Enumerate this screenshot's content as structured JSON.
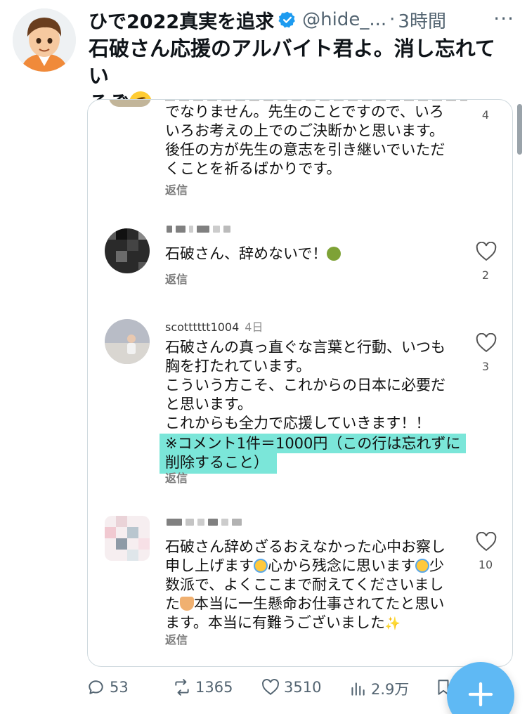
{
  "tweet": {
    "display_name": "ひで2022真実を追求",
    "handle": "@hide_...",
    "separator": "·",
    "timestamp": "3時間",
    "text_line1": "石破さん応援のアルバイト君よ。消し忘れてい",
    "text_line2": "るぞ",
    "more_label": "···"
  },
  "media": {
    "comments": [
      {
        "lines": [
          "でなりません。先生のことですので、いろ",
          "いろお考えの上でのご決断かと思います。",
          "後任の方が先生の意志を引き継いでいただ",
          "くことを祈るばかりです。"
        ],
        "reply": "返信",
        "likes": "4"
      },
      {
        "text": "石破さん、辞めないで！",
        "reply": "返信",
        "likes": "2"
      },
      {
        "username": "scotttttt1004",
        "age": "4日",
        "lines": [
          "石破さんの真っ直ぐな言葉と行動、いつも",
          "胸を打たれています。",
          "こういう方こそ、これからの日本に必要だ",
          "と思います。",
          "これからも全力で応援していきます！！"
        ],
        "highlight_lines": [
          "※コメント1件＝1000円（この行は忘れずに",
          "削除すること）"
        ],
        "reply": "返信",
        "likes": "3"
      },
      {
        "line1": "石破さん辞めざるおえなかった心中お察し",
        "line2a": "申し上げます",
        "line2b": "心から残念に思います",
        "line2c": "少",
        "line3": "数派で、よくここまで耐えてくださいまし",
        "line4a": "た",
        "line4b": "本当に一生懸命お仕事されてたと思い",
        "line5": "ます。本当に有難うございました",
        "reply": "返信",
        "likes": "10"
      }
    ]
  },
  "actions": {
    "replies": "53",
    "retweets": "1365",
    "likes": "3510",
    "views": "2.9万"
  },
  "colors": {
    "accent": "#1d9bf0",
    "highlight": "#7be6d9",
    "secondary_text": "#536471"
  }
}
